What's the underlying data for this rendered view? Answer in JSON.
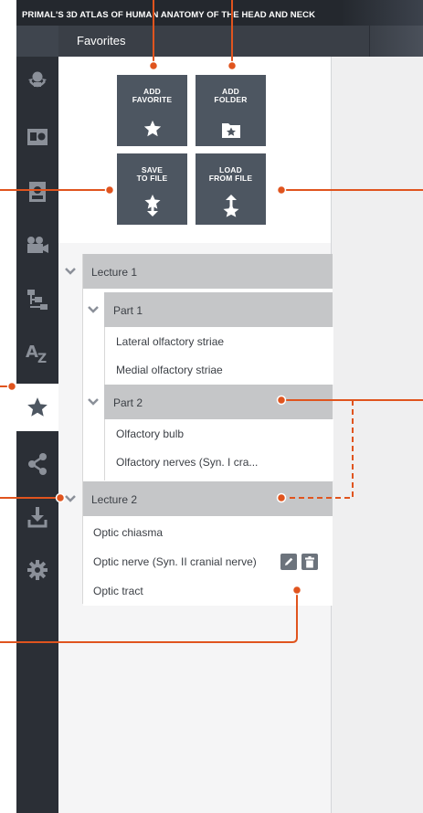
{
  "app": {
    "title": "PRIMAL'S 3D ATLAS OF HUMAN ANATOMY OF THE HEAD AND NECK"
  },
  "panel": {
    "title": "Favorites"
  },
  "sidebar": {
    "items": [
      {
        "icon": "rotate-model-icon",
        "active": false
      },
      {
        "icon": "slides-icon",
        "active": false
      },
      {
        "icon": "contact-card-icon",
        "active": false
      },
      {
        "icon": "video-camera-icon",
        "active": false
      },
      {
        "icon": "hierarchy-tree-icon",
        "active": false
      },
      {
        "icon": "a-z-index-icon",
        "active": false
      },
      {
        "icon": "star-icon",
        "active": true
      },
      {
        "icon": "share-icon",
        "active": false
      },
      {
        "icon": "download-icon",
        "active": false
      },
      {
        "icon": "settings-gear-icon",
        "active": false
      }
    ]
  },
  "buttons": {
    "add_favorite": "ADD\nFAVORITE",
    "add_folder": "ADD\nFOLDER",
    "save_to_file": "SAVE\nTO FILE",
    "load_from_file": "LOAD\nFROM FILE"
  },
  "tree": {
    "lecture1": {
      "label": "Lecture 1",
      "part1": {
        "label": "Part 1",
        "items": [
          "Lateral olfactory striae",
          "Medial olfactory striae"
        ]
      },
      "part2": {
        "label": "Part 2",
        "items": [
          "Olfactory bulb",
          "Olfactory nerves (Syn. I cra..."
        ]
      }
    },
    "lecture2": {
      "label": "Lecture 2",
      "items": [
        "Optic chiasma",
        "Optic nerve (Syn. II cranial nerve)",
        "Optic tract"
      ]
    }
  },
  "colors": {
    "accent_callout": "#e0541e",
    "sidebar_bg": "#2b2f36",
    "button_bg": "#4d5661",
    "group_row_bg": "#c5c6c8"
  }
}
